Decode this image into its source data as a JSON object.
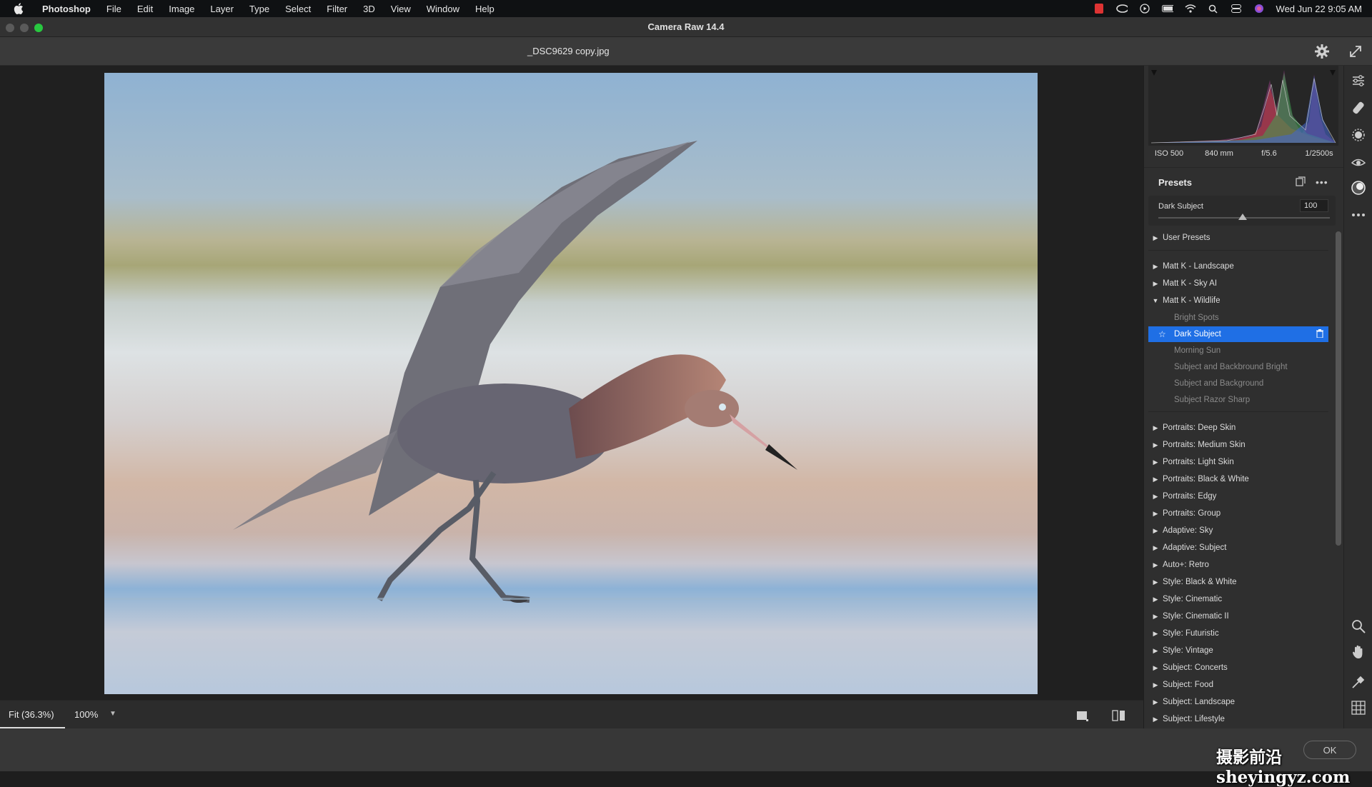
{
  "menubar": {
    "app_name": "Photoshop",
    "items": [
      "File",
      "Edit",
      "Image",
      "Layer",
      "Type",
      "Select",
      "Filter",
      "3D",
      "View",
      "Window",
      "Help"
    ],
    "clock": "Wed Jun 22  9:05 AM"
  },
  "window": {
    "title": "Camera Raw 14.4"
  },
  "toolbar": {
    "filename": "_DSC9629 copy.jpg"
  },
  "bottom": {
    "fit_label": "Fit (36.3%)",
    "zoom_label": "100%"
  },
  "exif": {
    "iso": "ISO 500",
    "focal": "840 mm",
    "aperture": "f/5.6",
    "shutter": "1/2500s"
  },
  "presets": {
    "title": "Presets",
    "active_name": "Dark Subject",
    "amount": "100",
    "amount_fraction": 0.5,
    "groups": [
      {
        "label": "User Presets",
        "expanded": false
      },
      {
        "label": "Matt K - Landscape",
        "expanded": false
      },
      {
        "label": "Matt K - Sky AI",
        "expanded": false
      },
      {
        "label": "Matt K - Wildlife",
        "expanded": true,
        "children": [
          "Bright Spots",
          "Dark Subject",
          "Morning Sun",
          "Subject and Backbround Bright",
          "Subject and Background",
          "Subject Razor Sharp"
        ],
        "selected_child": "Dark Subject"
      },
      {
        "label": "Portraits: Deep Skin",
        "expanded": false
      },
      {
        "label": "Portraits: Medium Skin",
        "expanded": false
      },
      {
        "label": "Portraits: Light Skin",
        "expanded": false
      },
      {
        "label": "Portraits: Black & White",
        "expanded": false
      },
      {
        "label": "Portraits: Edgy",
        "expanded": false
      },
      {
        "label": "Portraits: Group",
        "expanded": false
      },
      {
        "label": "Adaptive: Sky",
        "expanded": false
      },
      {
        "label": "Adaptive: Subject",
        "expanded": false
      },
      {
        "label": "Auto+: Retro",
        "expanded": false
      },
      {
        "label": "Style: Black & White",
        "expanded": false
      },
      {
        "label": "Style: Cinematic",
        "expanded": false
      },
      {
        "label": "Style: Cinematic II",
        "expanded": false
      },
      {
        "label": "Style: Futuristic",
        "expanded": false
      },
      {
        "label": "Style: Vintage",
        "expanded": false
      },
      {
        "label": "Subject: Concerts",
        "expanded": false
      },
      {
        "label": "Subject: Food",
        "expanded": false
      },
      {
        "label": "Subject: Landscape",
        "expanded": false
      },
      {
        "label": "Subject: Lifestyle",
        "expanded": false
      }
    ]
  },
  "footer": {
    "ok_label": "OK"
  },
  "watermark": "摄影前沿 sheyingyz.com",
  "colors": {
    "selection": "#1f6fe5",
    "panel": "#2f2f2f",
    "canvas": "#202020"
  },
  "tool_icons": [
    "edit-sliders-icon",
    "heal-brush-icon",
    "mask-icon",
    "red-eye-icon",
    "presets-icon",
    "more-icon",
    "zoom-icon",
    "hand-icon",
    "color-sampler-icon",
    "grid-icon"
  ]
}
